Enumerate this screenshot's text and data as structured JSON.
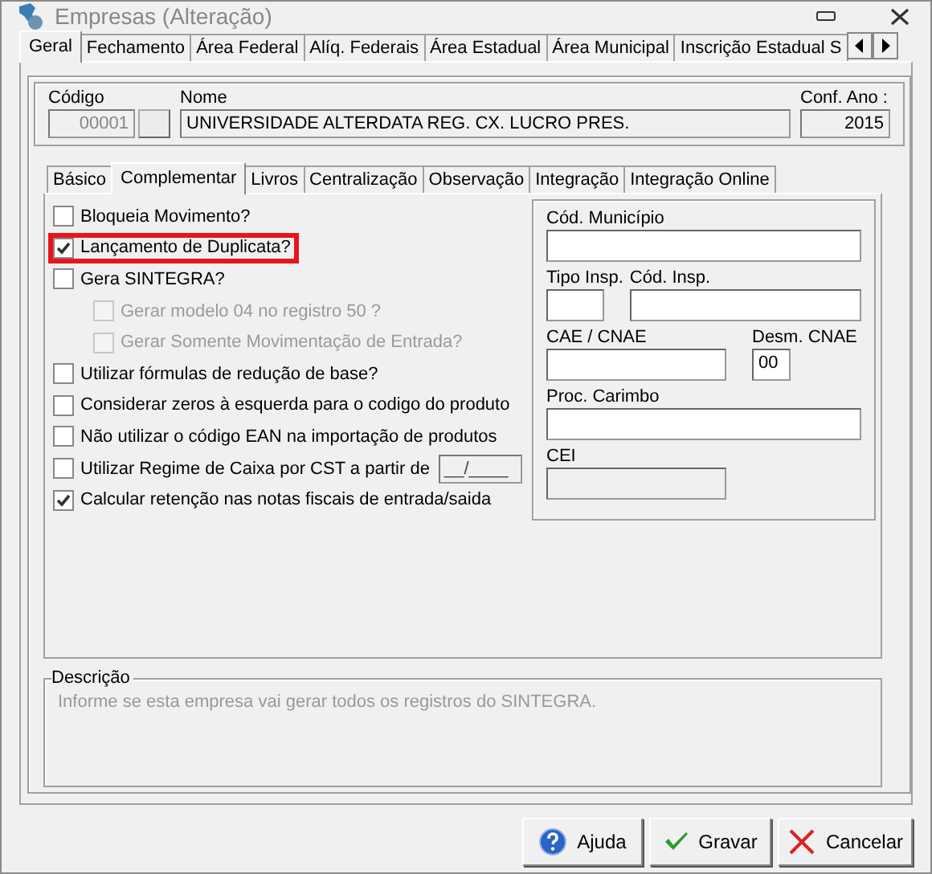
{
  "window": {
    "title": "Empresas (Alteração)"
  },
  "tabs": [
    {
      "label": "Geral",
      "selected": true
    },
    {
      "label": "Fechamento",
      "selected": false
    },
    {
      "label": "Área Federal",
      "selected": false
    },
    {
      "label": "Alíq. Federais",
      "selected": false
    },
    {
      "label": "Área Estadual",
      "selected": false
    },
    {
      "label": "Área Municipal",
      "selected": false
    },
    {
      "label": "Inscrição Estadual S",
      "selected": false
    }
  ],
  "header": {
    "codigo_label": "Código",
    "codigo_value": "00001",
    "nome_label": "Nome",
    "nome_value": "UNIVERSIDADE ALTERDATA REG. CX. LUCRO PRES.",
    "ano_label": "Conf. Ano :",
    "ano_value": "2015"
  },
  "subtabs": [
    {
      "label": "Básico",
      "selected": false
    },
    {
      "label": "Complementar",
      "selected": true
    },
    {
      "label": "Livros",
      "selected": false
    },
    {
      "label": "Centralização",
      "selected": false
    },
    {
      "label": "Observação",
      "selected": false
    },
    {
      "label": "Integração",
      "selected": false
    },
    {
      "label": "Integração Online",
      "selected": false
    }
  ],
  "options": [
    {
      "label": "Bloqueia Movimento?",
      "checked": false,
      "disabled": false,
      "highlighted": false
    },
    {
      "label": "Lançamento de Duplicata?",
      "checked": true,
      "disabled": false,
      "highlighted": true
    },
    {
      "label": "Gera SINTEGRA?",
      "checked": false,
      "disabled": false,
      "highlighted": false,
      "children": [
        {
          "label": "Gerar modelo 04 no registro 50 ?",
          "checked": false,
          "disabled": true,
          "highlighted": false
        },
        {
          "label": "Gerar Somente Movimentação de Entrada?",
          "checked": false,
          "disabled": true,
          "highlighted": false
        }
      ]
    },
    {
      "label": "Utilizar fórmulas de redução de base?",
      "checked": false,
      "disabled": false,
      "highlighted": false
    },
    {
      "label": "Considerar zeros à esquerda para o codigo do produto",
      "checked": false,
      "disabled": false,
      "highlighted": false
    },
    {
      "label": "Não utilizar o código EAN na importação de produtos",
      "checked": false,
      "disabled": false,
      "highlighted": false
    },
    {
      "label": "Utilizar Regime de Caixa por CST a partir de",
      "checked": false,
      "disabled": false,
      "highlighted": false,
      "date_field": {
        "value": "__/____",
        "disabled": true
      }
    },
    {
      "label": "Calcular retenção nas notas fiscais de entrada/saida",
      "checked": true,
      "disabled": false,
      "highlighted": false
    }
  ],
  "field_rows": [
    [
      {
        "label": "Cód. Município",
        "kind": "full",
        "disabled": false
      }
    ],
    [
      {
        "label": "Tipo Insp.",
        "kind": "small",
        "disabled": false
      },
      {
        "label": "Cód. Insp.",
        "kind": "rest",
        "disabled": false
      }
    ],
    [
      {
        "label": "CAE / CNAE",
        "kind": "medium",
        "disabled": false
      },
      {
        "label": "Desm. CNAE",
        "kind": "tiny",
        "value": "00",
        "disabled": false
      }
    ],
    [
      {
        "label": "Proc. Carimbo",
        "kind": "full",
        "disabled": false
      }
    ],
    [
      {
        "label": "CEI",
        "kind": "medium",
        "disabled": true
      }
    ]
  ],
  "description": {
    "label": "Descrição",
    "text": "Informe se esta empresa vai gerar todos os registros do SINTEGRA."
  },
  "buttons": [
    {
      "label": "Ajuda",
      "kind": "help"
    },
    {
      "label": "Gravar",
      "kind": "save"
    },
    {
      "label": "Cancelar",
      "kind": "cancel"
    }
  ]
}
